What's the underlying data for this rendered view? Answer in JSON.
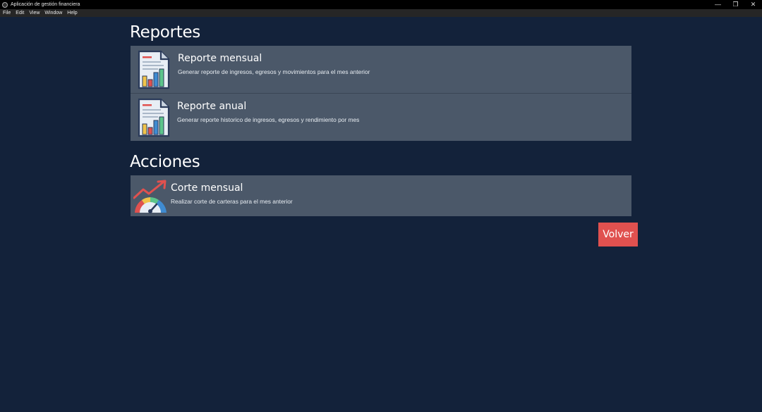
{
  "window": {
    "title": "Aplicación de gestión financiera",
    "controls": {
      "minimize": "—",
      "restore": "❐",
      "close": "✕"
    }
  },
  "menu": [
    "File",
    "Edit",
    "View",
    "Window",
    "Help"
  ],
  "reportes": {
    "heading": "Reportes",
    "items": [
      {
        "title": "Reporte mensual",
        "description": "Generar reporte de ingresos, egresos y movimientos para el mes anterior",
        "icon": "report-document-icon"
      },
      {
        "title": "Reporte anual",
        "description": "Generar reporte historico de ingresos, egresos y rendimiento por mes",
        "icon": "report-document-icon"
      }
    ]
  },
  "acciones": {
    "heading": "Acciones",
    "items": [
      {
        "title": "Corte mensual",
        "description": "Realizar corte de carteras para el mes anterior",
        "icon": "trend-gauge-icon"
      }
    ]
  },
  "volver_label": "Volver",
  "colors": {
    "background": "#13223a",
    "card": "#4b5869",
    "accent": "#e0514f"
  }
}
